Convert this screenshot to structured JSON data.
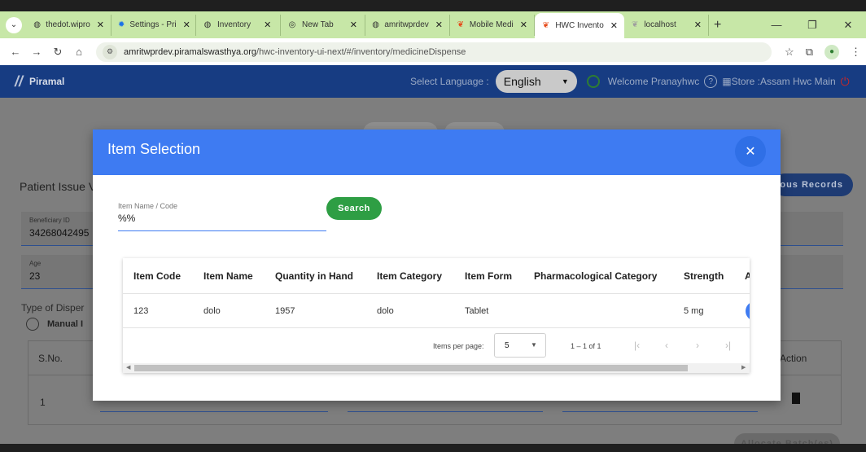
{
  "browser": {
    "tabs": [
      {
        "label": "thedot.wipro",
        "icon": "globe-icon"
      },
      {
        "label": "Settings - Pri",
        "icon": "gear-icon"
      },
      {
        "label": "Inventory",
        "icon": "globe-icon"
      },
      {
        "label": "New Tab",
        "icon": "chrome-icon"
      },
      {
        "label": "amritwprdev",
        "icon": "globe-icon"
      },
      {
        "label": "Mobile Medi",
        "icon": "app-icon"
      },
      {
        "label": "HWC Invento",
        "icon": "app-icon"
      },
      {
        "label": "localhost",
        "icon": "app-icon"
      }
    ],
    "active_tab_index": 6,
    "url_host": "amritwprdev.piramalswasthya.org",
    "url_path": "/hwc-inventory-ui-next/#/inventory/medicineDispense"
  },
  "header": {
    "brand": "Piramal",
    "select_language_label": "Select Language :",
    "language_value": "English",
    "welcome_text": "Welcome Pranayhwc",
    "store_text": "Store :Assam Hwc Main"
  },
  "page": {
    "title": "Patient Issue V",
    "previous_records_label": "ous Records",
    "beneficiary_label": "Beneficiary ID",
    "beneficiary_value": "34268042495",
    "age_label": "Age",
    "age_value": "23",
    "dispense_type_label": "Type of Disper",
    "manual_label": "Manual I",
    "grid_sno_header": "S.No.",
    "grid_action_header": "Action",
    "grid_row_no": "1",
    "allocate_label": "Allocate Batch(es)"
  },
  "modal": {
    "title": "Item Selection",
    "search_label": "Item Name / Code",
    "search_value": "%%",
    "search_button": "Search",
    "columns": [
      "Item Code",
      "Item Name",
      "Quantity in Hand",
      "Item Category",
      "Item Form",
      "Pharmacological Category",
      "Strength",
      "A"
    ],
    "rows": [
      [
        "123",
        "dolo",
        "1957",
        "dolo",
        "Tablet",
        "",
        "5 mg"
      ]
    ],
    "paginator": {
      "items_per_page_label": "Items per page:",
      "page_size": "5",
      "range": "1 – 1 of 1"
    }
  }
}
